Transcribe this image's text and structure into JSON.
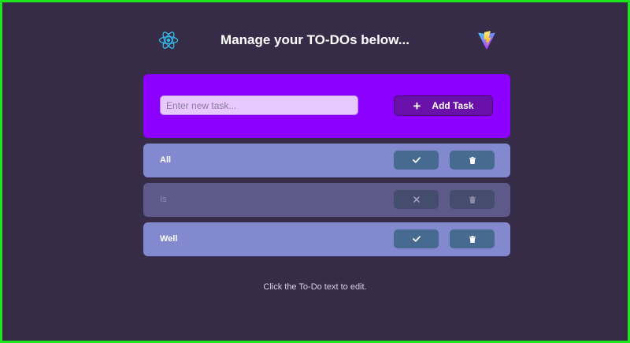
{
  "header": {
    "title": "Manage your TO-DOs below...",
    "left_logo": "react-logo",
    "right_logo": "vite-logo"
  },
  "add_form": {
    "placeholder": "Enter new task...",
    "value": "",
    "add_icon": "plus-icon",
    "add_label": "Add Task"
  },
  "todos": [
    {
      "text": "All",
      "completed": false,
      "toggle_icon": "check-icon",
      "delete_icon": "trash-icon"
    },
    {
      "text": "Is",
      "completed": true,
      "toggle_icon": "x-icon",
      "delete_icon": "trash-icon"
    },
    {
      "text": "Well",
      "completed": false,
      "toggle_icon": "check-icon",
      "delete_icon": "trash-icon"
    }
  ],
  "footer": {
    "hint": "Click the To-Do text to edit."
  },
  "colors": {
    "background": "#362c48",
    "panel": "#8c00ff",
    "row": "#8389cf",
    "row_done": "#5d5a8a",
    "button": "#476a91",
    "add_button": "#6810a8"
  }
}
